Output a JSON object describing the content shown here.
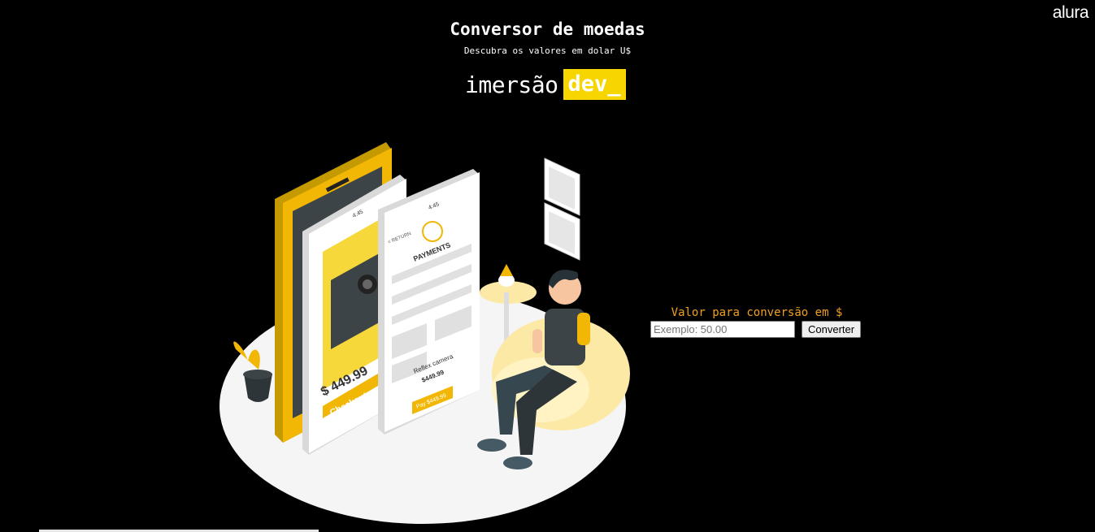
{
  "header": {
    "brand": "alura",
    "title": "Conversor de moedas",
    "subtitle": "Descubra os valores em dolar U$",
    "logo_text": "imersão",
    "logo_highlight": "dev_"
  },
  "illustration": {
    "phone_left": {
      "time": "4:45",
      "price": "$ 449.99",
      "button": "Checkout"
    },
    "phone_right": {
      "time": "4:45",
      "back": "< RETURN",
      "heading": "PAYMENTS",
      "fields": [
        "Email",
        "Password",
        "Card",
        "CVV",
        "Expiration Day"
      ],
      "product": "Reflex camera",
      "product_price": "$449.99",
      "pay_button": "Pay $449.99"
    }
  },
  "converter": {
    "label": "Valor para conversão em $",
    "placeholder": "Exemplo: 50.00",
    "value": "",
    "button_label": "Converter"
  },
  "colors": {
    "accent": "#f7d600",
    "label": "#f0a01e",
    "background": "#000000"
  }
}
